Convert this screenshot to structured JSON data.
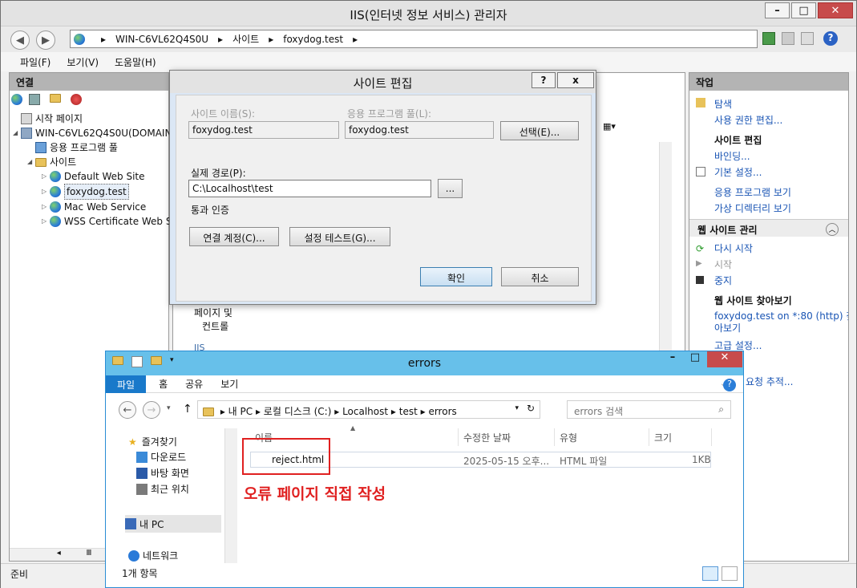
{
  "iis": {
    "title": "IIS(인터넷 정보 서비스) 관리자",
    "address": [
      "WIN-C6VL62Q4S0U",
      "사이트",
      "foxydog.test"
    ],
    "menu": [
      "파일(F)",
      "보기(V)",
      "도움말(H)"
    ],
    "connections_header": "연결",
    "tree": {
      "start": "시작 페이지",
      "server": "WIN-C6VL62Q4S0U(DOMAIN",
      "pools": "응용 프로그램 풀",
      "sites": "사이트",
      "site1": "Default Web Site",
      "site2": "foxydog.test",
      "site3": "Mac Web Service",
      "site4": "WSS Certificate Web S"
    },
    "center": {
      "pages": "페이지 및",
      "controls": "컨트롤",
      "iis_label": "IIS"
    },
    "actions_header": "작업",
    "actions": {
      "explore": "탐색",
      "edit_perm": "사용 권한 편집...",
      "site_edit": "사이트 편집",
      "bindings": "바인딩...",
      "basic": "기본 설정...",
      "view_apps": "응용 프로그램 보기",
      "view_vdirs": "가상 디렉터리 보기",
      "manage": "웹 사이트 관리",
      "restart": "다시 시작",
      "start": "시작",
      "stop": "중지",
      "browse_hdr": "웹 사이트 찾아보기",
      "browse_link1": "foxydog.test on *:80 (http) 찾",
      "browse_link2": "아보기",
      "advanced": "고급 설정...",
      "failed_req": "요청 추적..."
    },
    "status": "준비"
  },
  "dialog": {
    "title": "사이트 편집",
    "help": "?",
    "close": "x",
    "site_name_label": "사이트 이름(S):",
    "site_name": "foxydog.test",
    "pool_label": "응용 프로그램 풀(L):",
    "pool": "foxydog.test",
    "select": "선택(E)...",
    "path_label": "실제 경로(P):",
    "path": "C:\\Localhost\\test",
    "browse": "...",
    "auth_label": "통과 인증",
    "connect_as": "연결 계정(C)...",
    "test_settings": "설정 테스트(G)...",
    "ok": "확인",
    "cancel": "취소"
  },
  "explorer": {
    "title": "errors",
    "tabs": [
      "파일",
      "홈",
      "공유",
      "보기"
    ],
    "path": [
      "내 PC",
      "로컬 디스크 (C:)",
      "Localhost",
      "test",
      "errors"
    ],
    "search_placeholder": "errors 검색",
    "nav": {
      "favorites": "즐겨찾기",
      "downloads": "다운로드",
      "desktop": "바탕 화면",
      "recent": "최근 위치",
      "mypc": "내 PC",
      "network": "네트워크"
    },
    "columns": [
      "이름",
      "수정한 날짜",
      "유형",
      "크기"
    ],
    "file": {
      "name": "reject.html",
      "date": "2025-05-15 오후...",
      "type": "HTML 파일",
      "size": "1KB"
    },
    "annotation": "오류 페이지 직접 작성",
    "item_count": "1개 항목"
  },
  "colors": {
    "explorer_title": "#67c0ea",
    "file_tab": "#1979ca",
    "annotation": "#e02020"
  }
}
